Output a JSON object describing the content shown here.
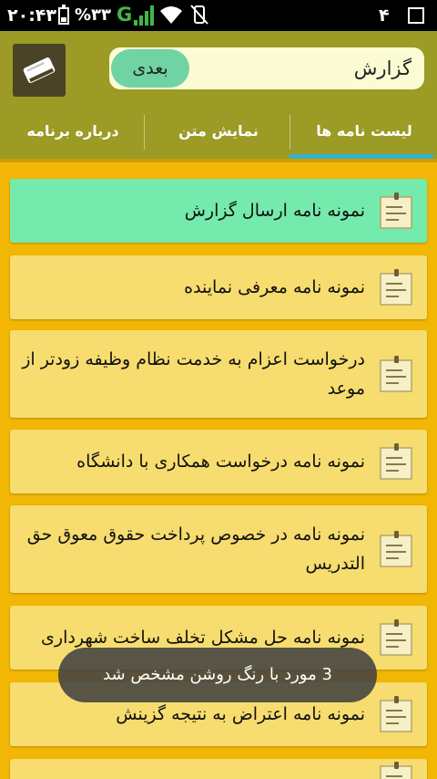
{
  "status_bar": {
    "time": "۲۰:۴۳",
    "battery_percent": "%۳۳",
    "battery_level": 0.33,
    "network_type": "G",
    "notification_count": "۴"
  },
  "header": {
    "search_value": "گزارش",
    "next_label": "بعدی"
  },
  "tabs": [
    {
      "label": "لیست نامه ها",
      "selected": true
    },
    {
      "label": "نمایش متن",
      "selected": false
    },
    {
      "label": "درباره برنامه",
      "selected": false
    }
  ],
  "items": [
    {
      "text": "نمونه نامه ارسال گزارش",
      "highlighted": true
    },
    {
      "text": "نمونه نامه معرفی نماینده",
      "highlighted": false
    },
    {
      "text": "درخواست اعزام به خدمت نظام وظیفه زودتر از موعد",
      "highlighted": false
    },
    {
      "text": "نمونه نامه درخواست همکاری با دانشگاه",
      "highlighted": false
    },
    {
      "text": "نمونه نامه در خصوص پرداخت حقوق معوق حق التدریس",
      "highlighted": false
    },
    {
      "text": "نمونه نامه حل مشکل تخلف ساخت شهرداری",
      "highlighted": false
    },
    {
      "text": "نمونه نامه اعتراض به نتیجه گزینش",
      "highlighted": false
    },
    {
      "text": "",
      "highlighted": false
    }
  ],
  "toast": {
    "message": "3 مورد با رنگ روشن مشخص شد"
  },
  "colors": {
    "header_bg": "#9b9b25",
    "list_bg": "#f2b705",
    "item_bg": "#f7dc6f",
    "item_highlight": "#74ebad",
    "tab_indicator": "#36b3c8"
  }
}
